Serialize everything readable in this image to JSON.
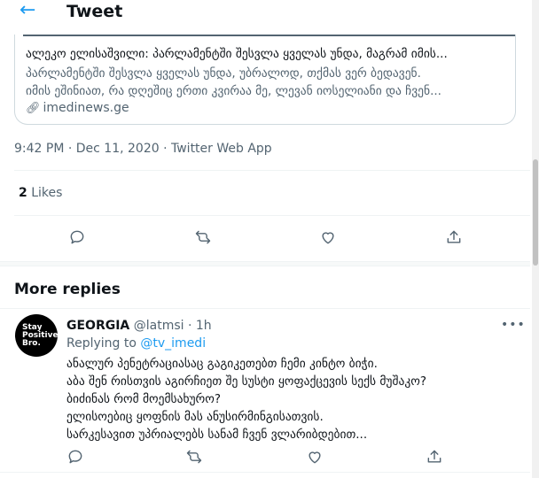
{
  "header": {
    "back_icon": "arrow-left-icon",
    "title": "Tweet"
  },
  "link_card": {
    "title": "ალეკო ელისაშვილი: პარლამენტში შესვლა ყველას უნდა, მაგრამ იმის...",
    "description_lines": [
      "პარლამენტში შესვლა ყველას უნდა, უბრალოდ, თქმას ვერ ბედავენ.",
      "იმის ეშინიათ, რა დღეშიც ერთი კვირაა მე, ლევან იოსელიანი და ჩვენ..."
    ],
    "link_icon": "link-icon",
    "domain": "imedinews.ge"
  },
  "tweet_meta": {
    "text": "9:42 PM · Dec 11, 2020 · Twitter Web App"
  },
  "stats": {
    "likes_count": "2",
    "likes_label": "Likes"
  },
  "actions": [
    {
      "icon": "reply-icon"
    },
    {
      "icon": "retweet-icon"
    },
    {
      "icon": "like-icon"
    },
    {
      "icon": "share-icon"
    }
  ],
  "more_replies": {
    "heading": "More replies",
    "reply": {
      "avatar_text_lines": [
        "Stay",
        "Positive",
        "Bro."
      ],
      "name": "GEORGIA",
      "handle": "@latmsi",
      "time": "· 1h",
      "menu_icon": "more-icon",
      "replying_prefix": "Replying to",
      "replying_to": "@tv_imedi",
      "text_lines": [
        "ანალურ პენეტრაციასაც გაგიკეთებთ ჩემი კინტო ბიჭი.",
        "აბა შენ რისთვის აგირჩიეთ შე სუსტი ყოფაქცევის სექს მუშაკო?",
        "ბიძინას რომ მოემსახურო?",
        "ელისოებიც ყოფნის მას ანუსირმინგისათვის.",
        "სარკესავით უპრიალებს სანამ ჩვენ ვლარიბდებით..."
      ]
    }
  },
  "colors": {
    "accent": "#1d9bf0",
    "secondary_text": "#536471",
    "border": "#cfd9de"
  }
}
